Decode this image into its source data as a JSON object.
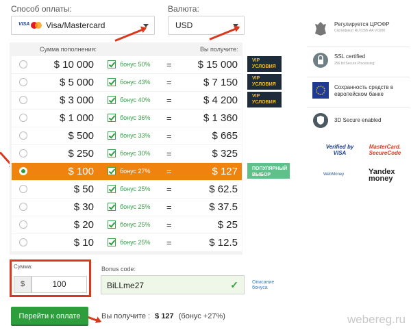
{
  "payment": {
    "method_label": "Способ оплаты:",
    "method_value": "Visa/Mastercard",
    "currency_label": "Валюта:",
    "currency_value": "USD"
  },
  "table": {
    "col_amount": "Сумма пополнения:",
    "col_receive": "Вы получите:",
    "rows": [
      {
        "amount": "$ 10 000",
        "bonus": "бонус 50%",
        "eq": "=",
        "get": "$ 15 000",
        "tag": "VIP УСЛОВИЯ"
      },
      {
        "amount": "$ 5 000",
        "bonus": "бонус 43%",
        "eq": "=",
        "get": "$ 7 150",
        "tag": "VIP УСЛОВИЯ"
      },
      {
        "amount": "$ 3 000",
        "bonus": "бонус 40%",
        "eq": "=",
        "get": "$ 4 200",
        "tag": "VIP УСЛОВИЯ"
      },
      {
        "amount": "$ 1 000",
        "bonus": "бонус 36%",
        "eq": "=",
        "get": "$ 1 360"
      },
      {
        "amount": "$ 500",
        "bonus": "бонус 33%",
        "eq": "=",
        "get": "$ 665"
      },
      {
        "amount": "$ 250",
        "bonus": "бонус 30%",
        "eq": "=",
        "get": "$ 325"
      },
      {
        "amount": "$ 100",
        "bonus": "бонус 27%",
        "eq": "=",
        "get": "$ 127",
        "tag": "ПОПУЛЯРНЫЙ ВЫБОР",
        "selected": true
      },
      {
        "amount": "$ 50",
        "bonus": "бонус 25%",
        "eq": "=",
        "get": "$ 62.5"
      },
      {
        "amount": "$ 30",
        "bonus": "бонус 25%",
        "eq": "=",
        "get": "$ 37.5"
      },
      {
        "amount": "$ 20",
        "bonus": "бонус 25%",
        "eq": "=",
        "get": "$ 25"
      },
      {
        "amount": "$ 10",
        "bonus": "бонус 25%",
        "eq": "=",
        "get": "$ 12.5"
      }
    ]
  },
  "sum": {
    "label": "Сумма:",
    "currency": "$",
    "value": "100"
  },
  "bonus_code": {
    "label": "Bonus code:",
    "value": "BiLLme27",
    "link": "Описание бонуса"
  },
  "submit_label": "Перейти к оплате",
  "summary": {
    "label": "Вы получите :",
    "value": "$ 127",
    "bonus": "(бонус +27%)"
  },
  "sidebar": {
    "cbr_title": "Регулируется ЦРОФР",
    "cbr_sub": "Сертификат RU 0395 АА V.0286",
    "ssl_title": "SSL certified",
    "ssl_sub": "256 bit Secure Processing",
    "eu_text": "Сохранность средств в европейском банке",
    "secure_text": "3D Secure enabled",
    "verified_visa": "Verified by VISA",
    "mastercard": "MasterCard. SecureCode",
    "webmoney": "WebMoney",
    "yandex": "Yandex money"
  },
  "watermark": "webereg.ru",
  "colors": {
    "orange": "#f0820f",
    "green": "#2e9e3c",
    "red_arrow": "#d9381e",
    "vip_dark": "#1d2b3a",
    "popular_green": "#5fc08a"
  }
}
